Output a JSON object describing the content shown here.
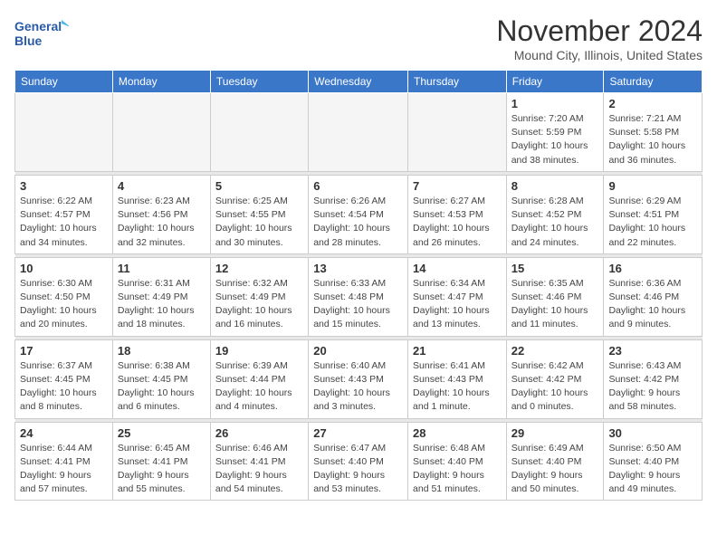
{
  "logo": {
    "line1": "General",
    "line2": "Blue"
  },
  "title": "November 2024",
  "location": "Mound City, Illinois, United States",
  "weekdays": [
    "Sunday",
    "Monday",
    "Tuesday",
    "Wednesday",
    "Thursday",
    "Friday",
    "Saturday"
  ],
  "weeks": [
    [
      {
        "day": "",
        "info": ""
      },
      {
        "day": "",
        "info": ""
      },
      {
        "day": "",
        "info": ""
      },
      {
        "day": "",
        "info": ""
      },
      {
        "day": "",
        "info": ""
      },
      {
        "day": "1",
        "info": "Sunrise: 7:20 AM\nSunset: 5:59 PM\nDaylight: 10 hours\nand 38 minutes."
      },
      {
        "day": "2",
        "info": "Sunrise: 7:21 AM\nSunset: 5:58 PM\nDaylight: 10 hours\nand 36 minutes."
      }
    ],
    [
      {
        "day": "3",
        "info": "Sunrise: 6:22 AM\nSunset: 4:57 PM\nDaylight: 10 hours\nand 34 minutes."
      },
      {
        "day": "4",
        "info": "Sunrise: 6:23 AM\nSunset: 4:56 PM\nDaylight: 10 hours\nand 32 minutes."
      },
      {
        "day": "5",
        "info": "Sunrise: 6:25 AM\nSunset: 4:55 PM\nDaylight: 10 hours\nand 30 minutes."
      },
      {
        "day": "6",
        "info": "Sunrise: 6:26 AM\nSunset: 4:54 PM\nDaylight: 10 hours\nand 28 minutes."
      },
      {
        "day": "7",
        "info": "Sunrise: 6:27 AM\nSunset: 4:53 PM\nDaylight: 10 hours\nand 26 minutes."
      },
      {
        "day": "8",
        "info": "Sunrise: 6:28 AM\nSunset: 4:52 PM\nDaylight: 10 hours\nand 24 minutes."
      },
      {
        "day": "9",
        "info": "Sunrise: 6:29 AM\nSunset: 4:51 PM\nDaylight: 10 hours\nand 22 minutes."
      }
    ],
    [
      {
        "day": "10",
        "info": "Sunrise: 6:30 AM\nSunset: 4:50 PM\nDaylight: 10 hours\nand 20 minutes."
      },
      {
        "day": "11",
        "info": "Sunrise: 6:31 AM\nSunset: 4:49 PM\nDaylight: 10 hours\nand 18 minutes."
      },
      {
        "day": "12",
        "info": "Sunrise: 6:32 AM\nSunset: 4:49 PM\nDaylight: 10 hours\nand 16 minutes."
      },
      {
        "day": "13",
        "info": "Sunrise: 6:33 AM\nSunset: 4:48 PM\nDaylight: 10 hours\nand 15 minutes."
      },
      {
        "day": "14",
        "info": "Sunrise: 6:34 AM\nSunset: 4:47 PM\nDaylight: 10 hours\nand 13 minutes."
      },
      {
        "day": "15",
        "info": "Sunrise: 6:35 AM\nSunset: 4:46 PM\nDaylight: 10 hours\nand 11 minutes."
      },
      {
        "day": "16",
        "info": "Sunrise: 6:36 AM\nSunset: 4:46 PM\nDaylight: 10 hours\nand 9 minutes."
      }
    ],
    [
      {
        "day": "17",
        "info": "Sunrise: 6:37 AM\nSunset: 4:45 PM\nDaylight: 10 hours\nand 8 minutes."
      },
      {
        "day": "18",
        "info": "Sunrise: 6:38 AM\nSunset: 4:45 PM\nDaylight: 10 hours\nand 6 minutes."
      },
      {
        "day": "19",
        "info": "Sunrise: 6:39 AM\nSunset: 4:44 PM\nDaylight: 10 hours\nand 4 minutes."
      },
      {
        "day": "20",
        "info": "Sunrise: 6:40 AM\nSunset: 4:43 PM\nDaylight: 10 hours\nand 3 minutes."
      },
      {
        "day": "21",
        "info": "Sunrise: 6:41 AM\nSunset: 4:43 PM\nDaylight: 10 hours\nand 1 minute."
      },
      {
        "day": "22",
        "info": "Sunrise: 6:42 AM\nSunset: 4:42 PM\nDaylight: 10 hours\nand 0 minutes."
      },
      {
        "day": "23",
        "info": "Sunrise: 6:43 AM\nSunset: 4:42 PM\nDaylight: 9 hours\nand 58 minutes."
      }
    ],
    [
      {
        "day": "24",
        "info": "Sunrise: 6:44 AM\nSunset: 4:41 PM\nDaylight: 9 hours\nand 57 minutes."
      },
      {
        "day": "25",
        "info": "Sunrise: 6:45 AM\nSunset: 4:41 PM\nDaylight: 9 hours\nand 55 minutes."
      },
      {
        "day": "26",
        "info": "Sunrise: 6:46 AM\nSunset: 4:41 PM\nDaylight: 9 hours\nand 54 minutes."
      },
      {
        "day": "27",
        "info": "Sunrise: 6:47 AM\nSunset: 4:40 PM\nDaylight: 9 hours\nand 53 minutes."
      },
      {
        "day": "28",
        "info": "Sunrise: 6:48 AM\nSunset: 4:40 PM\nDaylight: 9 hours\nand 51 minutes."
      },
      {
        "day": "29",
        "info": "Sunrise: 6:49 AM\nSunset: 4:40 PM\nDaylight: 9 hours\nand 50 minutes."
      },
      {
        "day": "30",
        "info": "Sunrise: 6:50 AM\nSunset: 4:40 PM\nDaylight: 9 hours\nand 49 minutes."
      }
    ]
  ]
}
